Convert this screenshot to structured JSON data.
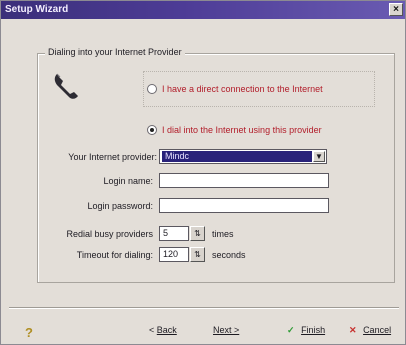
{
  "window": {
    "title": "Setup Wizard",
    "close_glyph": "×"
  },
  "group": {
    "label": "Dialing into your Internet Provider"
  },
  "options": {
    "direct": "I have a direct connection to the Internet",
    "dial": "I dial into the Internet using this provider",
    "selected": "dial"
  },
  "form": {
    "provider_label": "Your Internet provider:",
    "provider_value": "Mindc",
    "login_label": "Login name:",
    "password_label": "Login password:",
    "redial_label": "Redial busy providers",
    "redial_value": "5",
    "redial_unit": "times",
    "timeout_label": "Timeout for dialing:",
    "timeout_value": "120",
    "timeout_unit": "seconds"
  },
  "buttons": {
    "back": "Back",
    "next": "Next >",
    "finish": "Finish",
    "cancel": "Cancel",
    "help_glyph": "?"
  },
  "icons": {
    "phone": "phone-icon",
    "help": "help-icon",
    "finish": "checkmark-icon",
    "cancel": "x-icon"
  },
  "colors": {
    "titlebar": "#3b2f7a",
    "selection": "#29227a",
    "option_text": "#b21d2a",
    "dialog_bg": "#e3ded8"
  }
}
